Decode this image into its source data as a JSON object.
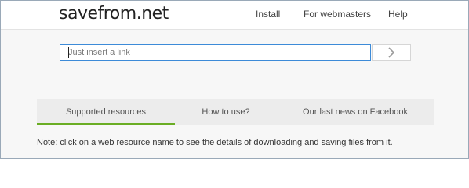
{
  "header": {
    "logo": "savefrom.net",
    "nav": [
      "Install",
      "For webmasters",
      "Help"
    ]
  },
  "search": {
    "placeholder": "Just insert a link",
    "value": ""
  },
  "tabs": [
    {
      "label": "Supported resources",
      "active": true
    },
    {
      "label": "How to use?",
      "active": false
    },
    {
      "label": "Our last news on Facebook",
      "active": false
    }
  ],
  "note": "Note: click on a web resource name to see the details of downloading and saving files from it.",
  "colors": {
    "input_border": "#3d8bd8",
    "tab_active_underline": "#6aad24",
    "tabs_background": "#ececec",
    "page_background": "#f7f7f7"
  },
  "icons": {
    "go": "chevron-right-icon"
  }
}
